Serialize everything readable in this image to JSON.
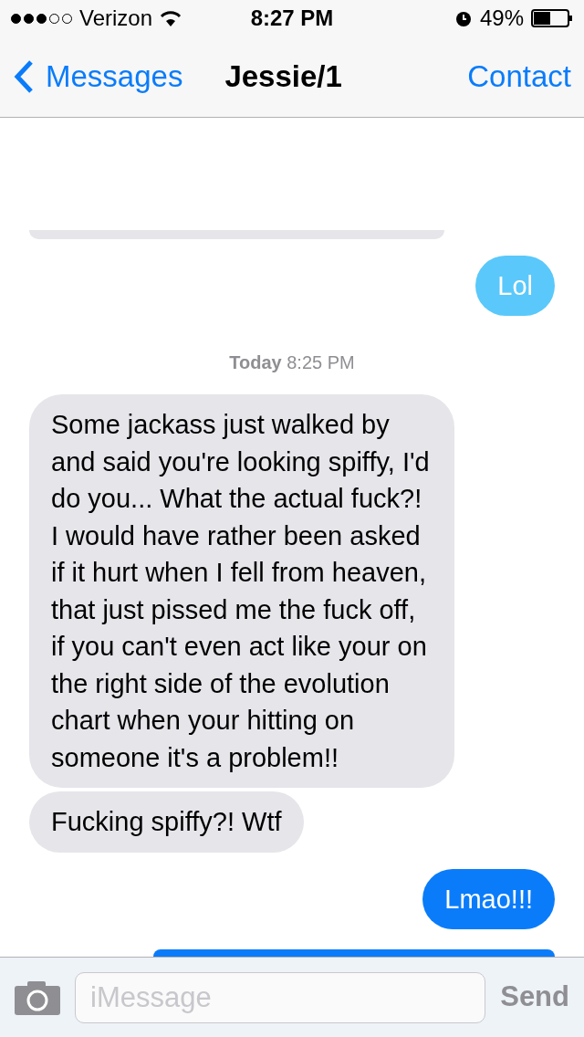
{
  "status_bar": {
    "carrier": "Verizon",
    "time": "8:27 PM",
    "battery": "49%"
  },
  "nav": {
    "back": "Messages",
    "title": "Jessie/1",
    "action": "Contact"
  },
  "messages": [
    {
      "kind": "received",
      "color": "#e5e5ea"
    },
    {
      "kind": "sent",
      "color": "#5ac8fa",
      "text": "Lol"
    },
    {
      "kind": "timestamp",
      "text": "**Today** 8:25 PM"
    },
    {
      "kind": "received",
      "color": "#e5e5ea",
      "text": "Some jackass just walked by and said you're looking spiffy, I'd do you... What the actual fuck?! I would have rather been asked if it hurt when I fell from heaven, that just pissed me the fuck off, if you can't even act like your on the right side of the evolution chart when your hitting on someone it's a problem!!"
    },
    {
      "kind": "received",
      "color": "#e5e5ea",
      "text": "Fucking spiffy?! Wtf"
    },
    {
      "kind": "sent",
      "color": "#0a7cfa",
      "text": "Lmao!!!"
    },
    {
      "kind": "sent",
      "color": "#0a7cfa"
    }
  ],
  "composer": {
    "placeholder": "iMessage",
    "send": "Send"
  }
}
